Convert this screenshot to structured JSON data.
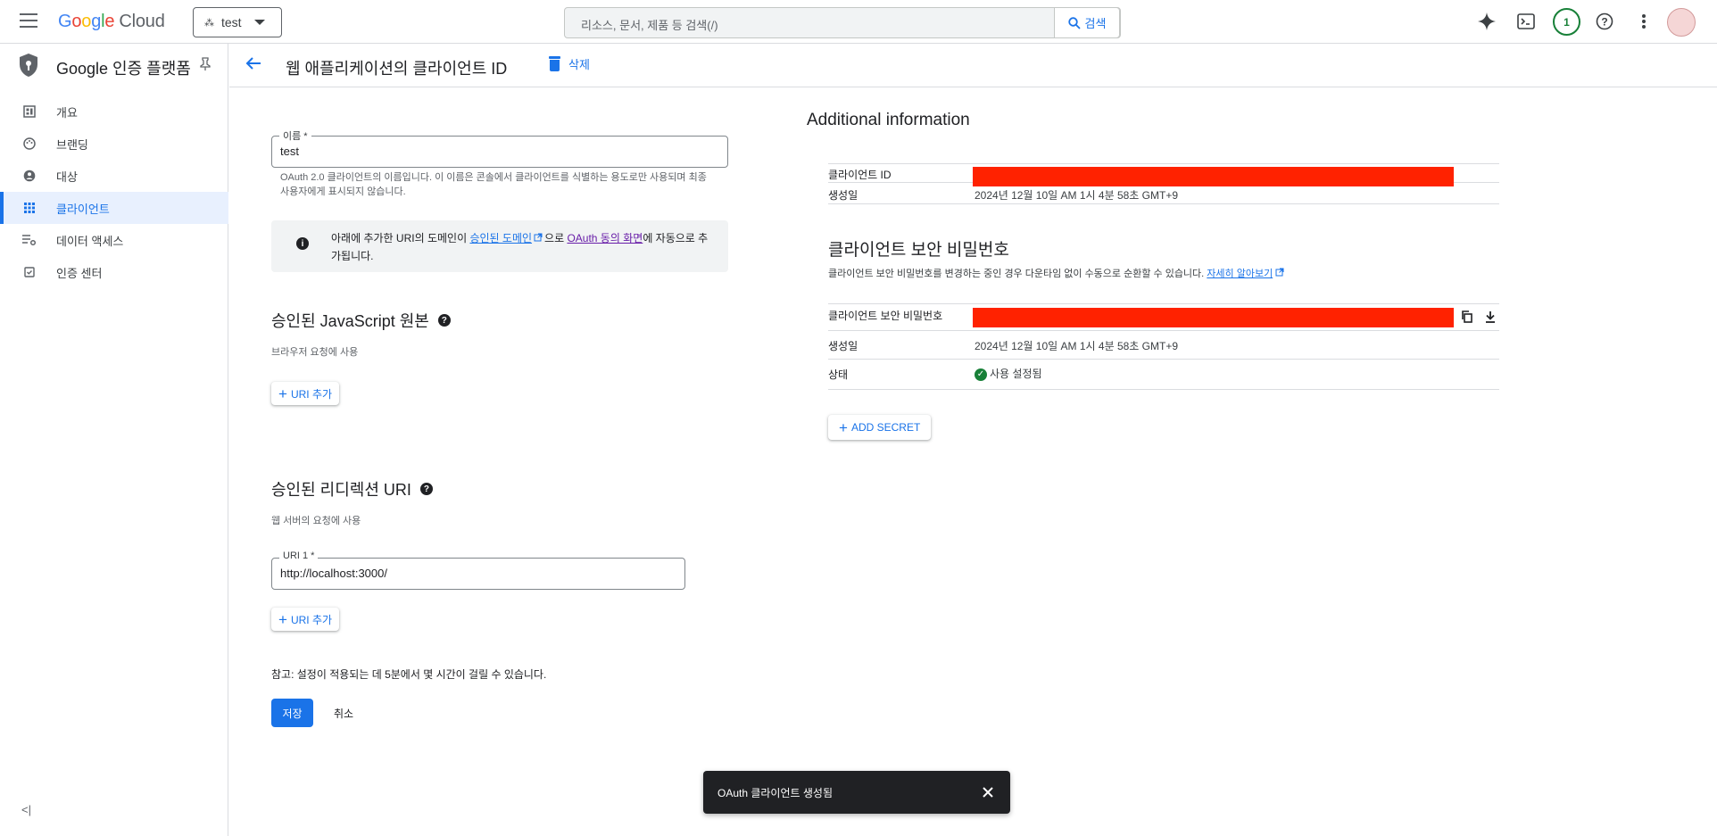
{
  "topbar": {
    "logo_letters": [
      "G",
      "o",
      "o",
      "g",
      "l",
      "e"
    ],
    "logo_cloud": "Cloud",
    "project": "test",
    "search_placeholder": "리소스, 문서, 제품 등 검색(/)",
    "search_button": "검색",
    "notification_count": "1",
    "icons": [
      "gemini-spark-icon",
      "cloud-shell-icon",
      "help-icon",
      "more-vert-icon",
      "avatar"
    ]
  },
  "sidebar": {
    "title": "Google 인증 플랫폼",
    "items": [
      {
        "label": "개요",
        "icon": "dashboard-icon",
        "active": false
      },
      {
        "label": "브랜딩",
        "icon": "palette-icon",
        "active": false
      },
      {
        "label": "대상",
        "icon": "person-icon",
        "active": false
      },
      {
        "label": "클라이언트",
        "icon": "apps-grid-icon",
        "active": true
      },
      {
        "label": "데이터 액세스",
        "icon": "settings-list-icon",
        "active": false
      },
      {
        "label": "인증 센터",
        "icon": "verified-box-icon",
        "active": false
      }
    ],
    "collapse": "<|"
  },
  "header": {
    "title": "웹 애플리케이션의 클라이언트 ID",
    "delete": "삭제"
  },
  "form": {
    "name_label": "이름 *",
    "name_value": "test",
    "name_hint": "OAuth 2.0 클라이언트의 이름입니다. 이 이름은 콘솔에서 클라이언트를 식별하는 용도로만 사용되며 최종 사용자에게 표시되지 않습니다.",
    "info_prefix": "아래에 추가한 URI의 도메인이 ",
    "info_link1": "승인된 도메인",
    "info_mid": "으로 ",
    "info_link2": "OAuth 동의 화면",
    "info_suffix": "에 자동으로 추가됩니다.",
    "js_title": "승인된 JavaScript 원본",
    "js_sub": "브라우저 요청에 사용",
    "add_uri": "URI 추가",
    "redirect_title": "승인된 리디렉션 URI",
    "redirect_sub": "웹 서버의 요청에 사용",
    "uri1_label": "URI 1 *",
    "uri1_value": "http://localhost:3000/",
    "note": "참고: 설정이 적용되는 데 5분에서 몇 시간이 걸릴 수 있습니다.",
    "save": "저장",
    "cancel": "취소"
  },
  "info": {
    "title": "Additional information",
    "client_id_key": "클라이언트 ID",
    "created_key": "생성일",
    "created_value": "2024년 12월 10일 AM 1시 4분 58초 GMT+9",
    "secret_title": "클라이언트 보안 비밀번호",
    "secret_desc": "클라이언트 보안 비밀번호를 변경하는 중인 경우 다운타임 없이 수동으로 순환할 수 있습니다.",
    "learn_more": "자세히 알아보기",
    "secret_key": "클라이언트 보안 비밀번호",
    "secret_created_key": "생성일",
    "secret_created_value": "2024년 12월 10일 AM 1시 4분 58초 GMT+9",
    "status_key": "상태",
    "status_value": "사용 설정됨",
    "add_secret": "ADD SECRET",
    "redaction_color": "#ff2200"
  },
  "snackbar": {
    "message": "OAuth 클라이언트 생성됨"
  }
}
